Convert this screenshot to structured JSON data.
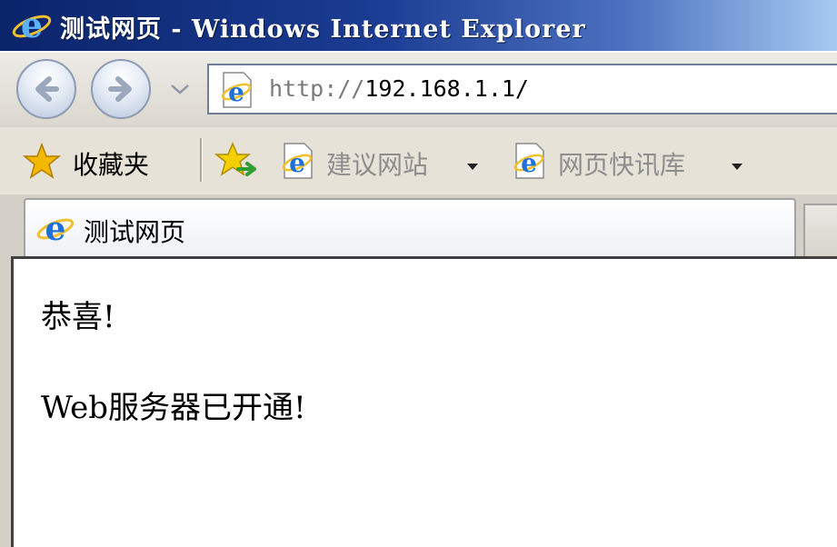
{
  "window": {
    "title": "测试网页 - Windows Internet Explorer"
  },
  "navigation": {
    "address_protocol": "http://",
    "address_host": "192.168.1.1/"
  },
  "favorites_bar": {
    "favorites_label": "收藏夹",
    "links": [
      {
        "label": "建议网站"
      },
      {
        "label": "网页快讯库"
      }
    ]
  },
  "tabs": [
    {
      "label": "测试网页"
    }
  ],
  "page": {
    "heading": "恭喜!",
    "message": "Web服务器已开通!"
  },
  "colors": {
    "title_bar": "#0a246a",
    "ie_blue": "#1e6fd9",
    "favorite_star": "#f5b800"
  }
}
